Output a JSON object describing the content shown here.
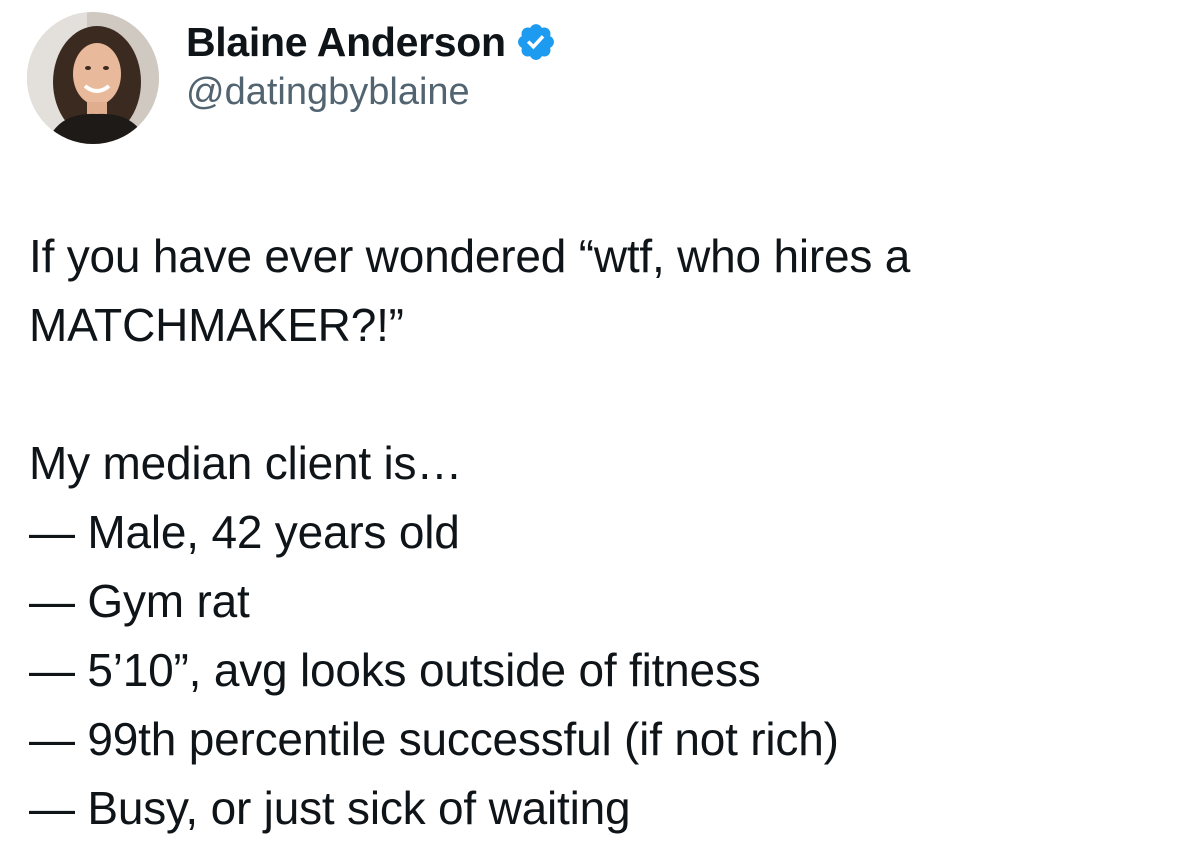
{
  "tweet": {
    "author": {
      "display_name": "Blaine Anderson",
      "handle": "@datingbyblaine",
      "verified": true,
      "verified_color": "#1d9bf0",
      "avatar_icon": "profile-photo"
    },
    "paragraphs": [
      [
        "If you have ever wondered “wtf, who hires a",
        "MATCHMAKER?!”"
      ],
      [
        "My median client is…"
      ]
    ],
    "list_items": [
      "— Male, 42 years old",
      "— Gym rat",
      "— 5’10”, avg looks outside of fitness",
      "— 99th percentile successful (if not rich)",
      "— Busy, or just sick of waiting"
    ]
  }
}
